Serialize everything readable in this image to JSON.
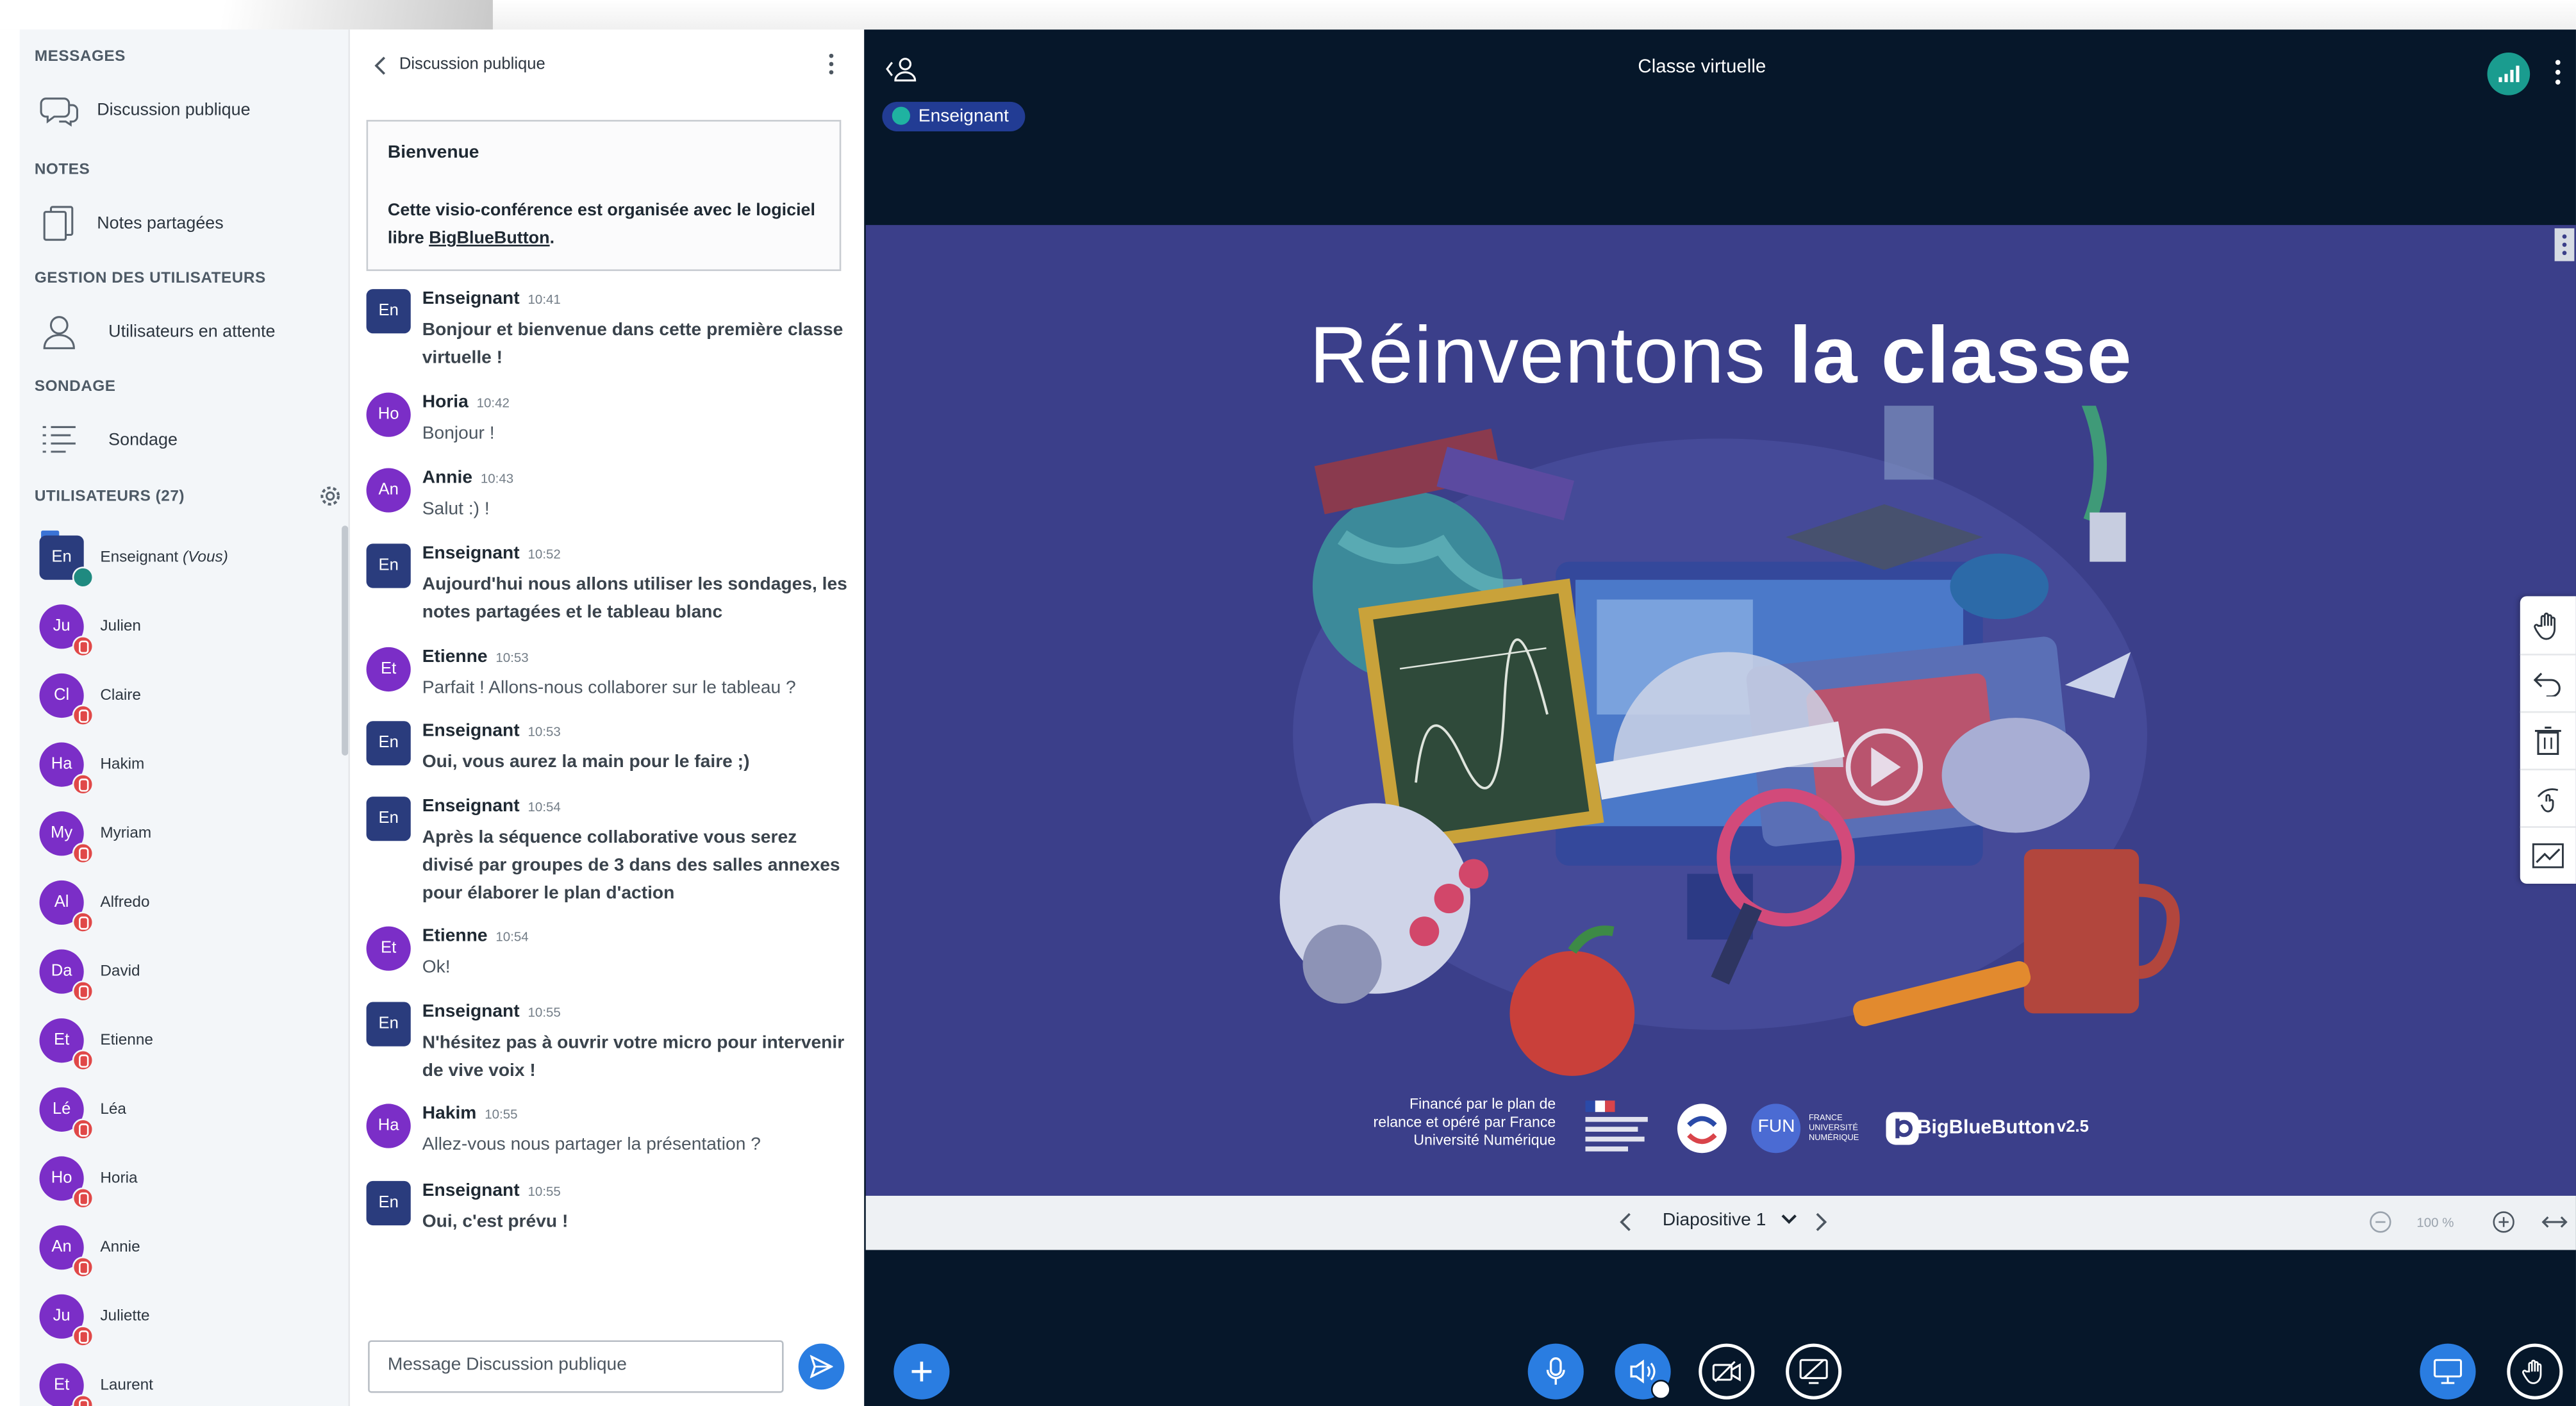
{
  "nav": {
    "messages_title": "MESSAGES",
    "public_chat": "Discussion publique",
    "notes_title": "NOTES",
    "shared_notes": "Notes partagées",
    "user_mgmt_title": "GESTION DES UTILISATEURS",
    "waiting_users": "Utilisateurs en attente",
    "poll_title": "SONDAGE",
    "poll": "Sondage",
    "users_title": "UTILISATEURS (27)"
  },
  "users": [
    {
      "initials": "En",
      "name": "Enseignant",
      "suffix": "(Vous)"
    },
    {
      "initials": "Ju",
      "name": "Julien"
    },
    {
      "initials": "Cl",
      "name": "Claire"
    },
    {
      "initials": "Ha",
      "name": "Hakim"
    },
    {
      "initials": "My",
      "name": "Myriam"
    },
    {
      "initials": "Al",
      "name": "Alfredo"
    },
    {
      "initials": "Da",
      "name": "David"
    },
    {
      "initials": "Et",
      "name": "Etienne"
    },
    {
      "initials": "Lé",
      "name": "Léa"
    },
    {
      "initials": "Ho",
      "name": "Horia"
    },
    {
      "initials": "An",
      "name": "Annie"
    },
    {
      "initials": "Ju",
      "name": "Juliette"
    },
    {
      "initials": "Et",
      "name": "Laurent"
    }
  ],
  "chat": {
    "title": "Discussion publique",
    "welcome_title": "Bienvenue",
    "welcome_text": "Cette visio-conférence est organisée avec le logiciel libre ",
    "welcome_link": "BigBlueButton",
    "welcome_end": ".",
    "placeholder": "Message Discussion publique",
    "messages": [
      {
        "initials": "En",
        "name": "Enseignant",
        "time": "10:41",
        "text": "Bonjour et bienvenue dans cette première classe virtuelle !"
      },
      {
        "initials": "Ho",
        "name": "Horia",
        "time": "10:42",
        "text": "Bonjour !"
      },
      {
        "initials": "An",
        "name": "Annie",
        "time": "10:43",
        "text": "Salut :) !"
      },
      {
        "initials": "En",
        "name": "Enseignant",
        "time": "10:52",
        "text": "Aujourd'hui nous allons utiliser les sondages, les notes partagées et le tableau blanc"
      },
      {
        "initials": "Et",
        "name": "Etienne",
        "time": "10:53",
        "text": "Parfait ! Allons-nous collaborer sur le tableau ?"
      },
      {
        "initials": "En",
        "name": "Enseignant",
        "time": "10:53",
        "text": "Oui, vous aurez la main pour le faire ;)"
      },
      {
        "initials": "En",
        "name": "Enseignant",
        "time": "10:54",
        "text": "Après la séquence collaborative vous serez divisé par groupes de 3 dans des salles annexes pour élaborer le plan d'action"
      },
      {
        "initials": "Et",
        "name": "Etienne",
        "time": "10:54",
        "text": "Ok!"
      },
      {
        "initials": "En",
        "name": "Enseignant",
        "time": "10:55",
        "text": "N'hésitez pas à ouvrir votre micro pour intervenir de vive voix !"
      },
      {
        "initials": "Ha",
        "name": "Hakim",
        "time": "10:55",
        "text": "Allez-vous nous partager la présentation ?"
      },
      {
        "initials": "En",
        "name": "Enseignant",
        "time": "10:55",
        "text": "Oui, c'est prévu !"
      }
    ]
  },
  "main": {
    "title": "Classe virtuelle",
    "presenter": "Enseignant",
    "slide_title_light": "Réinventons ",
    "slide_title_bold": "la classe",
    "slide_footer": "Financé par le plan de relance et opéré par France Université Numérique",
    "logo_fun": "FUN",
    "logo_fun_sub": "FRANCE UNIVERSITÉ NUMÉRIQUE",
    "logo_bbb": "BigBlueButton",
    "logo_version": "v2.5",
    "slide_selector": "Diapositive 1",
    "zoom": "100 %"
  },
  "colors": {
    "accent": "#2a7de1",
    "dark_bg": "#06172a",
    "slide_bg": "#3b3f8a",
    "avatar_purple": "#7b2ec7",
    "avatar_teacher": "#2a3c7d",
    "muted_red": "#e04848",
    "connection_green": "#1a9c8f"
  }
}
